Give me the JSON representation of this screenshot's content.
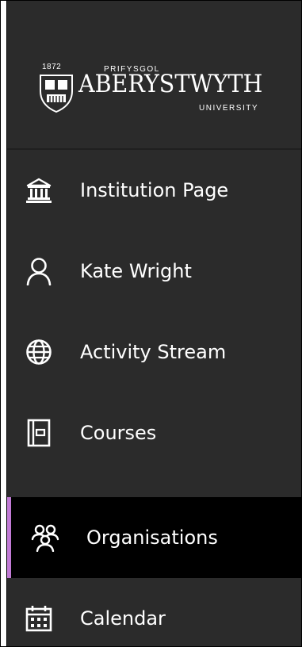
{
  "branding": {
    "year": "1872",
    "line1": "PRIFYSGOL",
    "name": "ABERYSTWYTH",
    "line3": "UNIVERSITY"
  },
  "nav": {
    "items": [
      {
        "label": "Institution Page",
        "icon": "institution-icon"
      },
      {
        "label": "Kate Wright",
        "icon": "user-icon"
      },
      {
        "label": "Activity Stream",
        "icon": "globe-icon"
      },
      {
        "label": "Courses",
        "icon": "courses-icon"
      },
      {
        "label": "Organisations",
        "icon": "organisations-icon",
        "active": true
      },
      {
        "label": "Calendar",
        "icon": "calendar-icon"
      }
    ]
  },
  "colors": {
    "background": "#2b2b2b",
    "active_background": "#000000",
    "accent": "#c27bd6",
    "text": "#ffffff"
  }
}
